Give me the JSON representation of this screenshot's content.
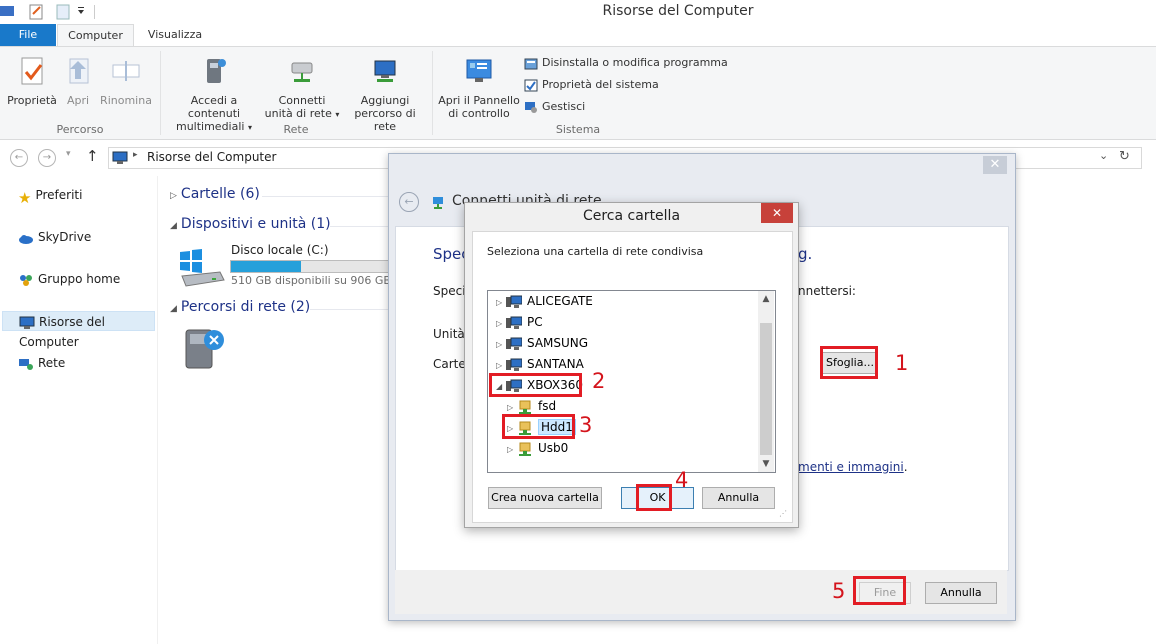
{
  "window": {
    "title": "Risorse del Computer"
  },
  "ribbon": {
    "tabs": [
      "File",
      "Computer",
      "Visualizza"
    ],
    "groups": {
      "percorso": {
        "label": "Percorso",
        "items": [
          "Proprietà",
          "Apri",
          "Rinomina"
        ]
      },
      "rete": {
        "label": "Rete",
        "items": [
          {
            "line1": "Accedi a contenuti",
            "line2": "multimediali"
          },
          {
            "line1": "Connetti",
            "line2": "unità di rete"
          },
          {
            "line1": "Aggiungi",
            "line2": "percorso di rete"
          }
        ]
      },
      "sistema": {
        "label": "Sistema",
        "big": {
          "line1": "Apri il Pannello",
          "line2": "di controllo"
        },
        "small": [
          "Disinstalla o modifica programma",
          "Proprietà del sistema",
          "Gestisci"
        ]
      }
    }
  },
  "address": {
    "path": "Risorse del Computer"
  },
  "nav": {
    "items": [
      "Preferiti",
      "SkyDrive",
      "Gruppo home",
      "Risorse del Computer",
      "Rete"
    ]
  },
  "content": {
    "sections": [
      "Cartelle (6)",
      "Dispositivi e unità (1)",
      "Percorsi di rete (2)"
    ],
    "drive": {
      "name": "Disco locale (C:)",
      "space": "510 GB disponibili su 906 GB",
      "free_fraction": 0.44
    }
  },
  "wizard": {
    "title": "Connetti unità di rete",
    "heading_start": "Spec",
    "heading_end": "g.",
    "line1_start": "Specif",
    "line1_end": "nnettersi:",
    "unit_label": "Unità:",
    "folder_label": "Cartel",
    "browse_button": "Sfoglia...",
    "link_tail": "menti e immagini",
    "link_dot": ".",
    "finish_button": "Fine",
    "cancel_button": "Annulla"
  },
  "browse": {
    "title": "Cerca cartella",
    "instruction": "Seleziona una cartella di rete condivisa",
    "tree": [
      {
        "label": "ALICEGATE",
        "level": 0,
        "expanded": false
      },
      {
        "label": "PC",
        "level": 0,
        "expanded": false
      },
      {
        "label": "SAMSUNG",
        "level": 0,
        "expanded": false
      },
      {
        "label": "SANTANA",
        "level": 0,
        "expanded": false
      },
      {
        "label": "XBOX360",
        "level": 0,
        "expanded": true
      },
      {
        "label": "fsd",
        "level": 1,
        "expanded": false
      },
      {
        "label": "Hdd1",
        "level": 1,
        "expanded": false,
        "selected": true
      },
      {
        "label": "Usb0",
        "level": 1,
        "expanded": false
      }
    ],
    "new_folder_button": "Crea nuova cartella",
    "ok_button": "OK",
    "cancel_button": "Annulla"
  },
  "annotations": [
    "1",
    "2",
    "3",
    "4",
    "5"
  ],
  "colors": {
    "accent": "#1979ca",
    "annotation": "#e21c24",
    "link": "#1e3287",
    "progress": "#26a0da"
  }
}
